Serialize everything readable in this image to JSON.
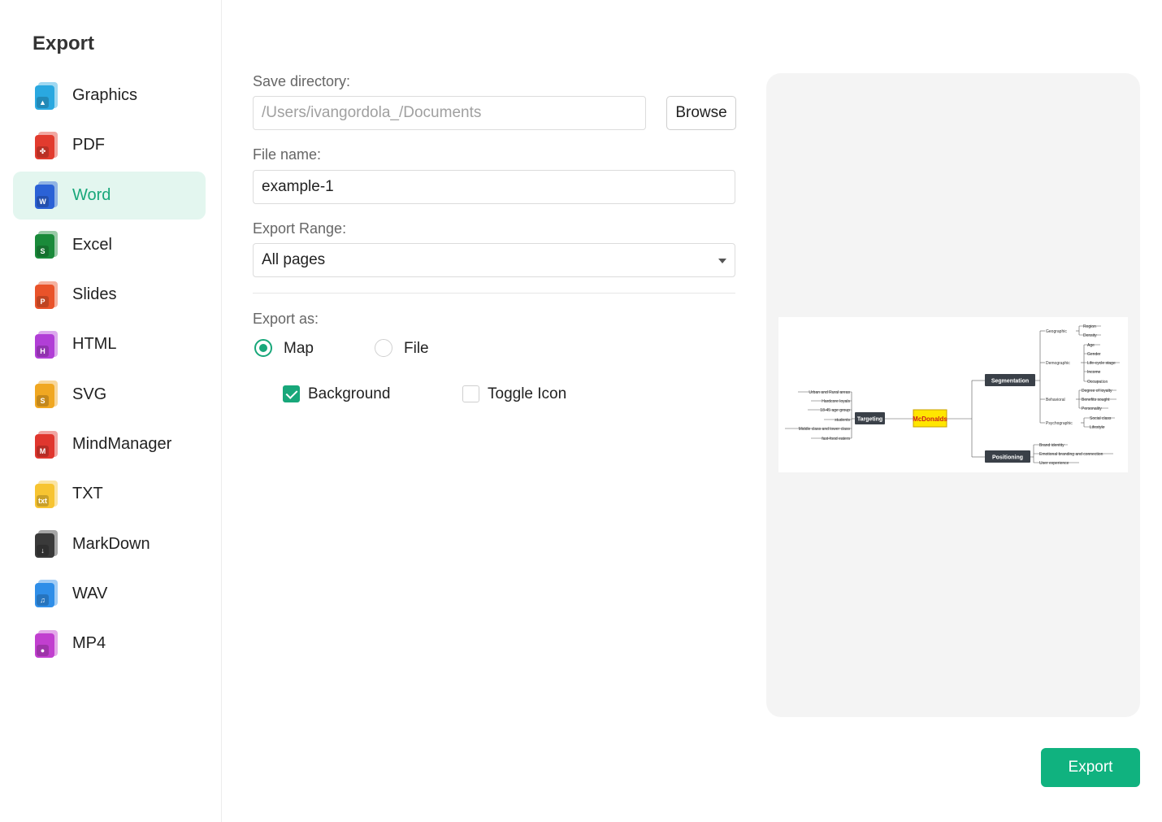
{
  "sidebar": {
    "title": "Export",
    "items": [
      {
        "label": "Graphics",
        "icon": "image-file-icon",
        "color": "#2aa8e0",
        "badge": "▲",
        "active": false
      },
      {
        "label": "PDF",
        "icon": "pdf-file-icon",
        "color": "#e23b2e",
        "badge": "✤",
        "active": false
      },
      {
        "label": "Word",
        "icon": "word-file-icon",
        "color": "#2b62d6",
        "badge": "W",
        "active": true
      },
      {
        "label": "Excel",
        "icon": "excel-file-icon",
        "color": "#1a8a3a",
        "badge": "S",
        "active": false
      },
      {
        "label": "Slides",
        "icon": "slides-file-icon",
        "color": "#e9532a",
        "badge": "P",
        "active": false
      },
      {
        "label": "HTML",
        "icon": "html-file-icon",
        "color": "#b13ed6",
        "badge": "H",
        "active": false
      },
      {
        "label": "SVG",
        "icon": "svg-file-icon",
        "color": "#f0a721",
        "badge": "S",
        "active": false
      },
      {
        "label": "MindManager",
        "icon": "mindmanager-file-icon",
        "color": "#e0362e",
        "badge": "M",
        "active": false
      },
      {
        "label": "TXT",
        "icon": "txt-file-icon",
        "color": "#f7c431",
        "badge": "txt",
        "active": false
      },
      {
        "label": "MarkDown",
        "icon": "markdown-file-icon",
        "color": "#3a3a3a",
        "badge": "↓",
        "active": false
      },
      {
        "label": "WAV",
        "icon": "wav-file-icon",
        "color": "#2f8ee8",
        "badge": "♫",
        "active": false
      },
      {
        "label": "MP4",
        "icon": "mp4-file-icon",
        "color": "#c13fcf",
        "badge": "●",
        "active": false
      }
    ]
  },
  "form": {
    "save_directory_label": "Save directory:",
    "save_directory_value": "/Users/ivangordola_/Documents",
    "browse_label": "Browse",
    "file_name_label": "File name:",
    "file_name_value": "example-1",
    "export_range_label": "Export Range:",
    "export_range_value": "All pages",
    "export_as_label": "Export as:",
    "export_as_options": [
      {
        "label": "Map",
        "checked": true
      },
      {
        "label": "File",
        "checked": false
      }
    ],
    "checkboxes": [
      {
        "label": "Background",
        "checked": true
      },
      {
        "label": "Toggle Icon",
        "checked": false
      }
    ]
  },
  "preview": {
    "center": "McDonalds",
    "left_branch": {
      "label": "Targeting",
      "children": [
        "Urban and Rural areas",
        "Hardcore loyals",
        "18-45 age group",
        "students",
        "Middle class and lower class",
        "fast-food eaters"
      ]
    },
    "segmentation": {
      "label": "Segmentation",
      "groups": [
        {
          "label": "Geographic",
          "children": [
            "Region",
            "Density"
          ]
        },
        {
          "label": "Demographic",
          "children": [
            "Age",
            "Gender",
            "Life-cycle stage",
            "Income",
            "Occupation"
          ]
        },
        {
          "label": "Behavioral",
          "children": [
            "Degree of loyalty",
            "Benefits sought",
            "Personality"
          ]
        },
        {
          "label": "Psychographic",
          "children": [
            "Social class",
            "Lifestyle"
          ]
        }
      ]
    },
    "positioning": {
      "label": "Positioning",
      "children": [
        "Brand identity",
        "Emotional branding and connection",
        "User experience"
      ]
    }
  },
  "export_button_label": "Export",
  "colors": {
    "accent": "#10b27f",
    "active_bg": "#e3f6ef",
    "close": "#ee5a52",
    "node_dark": "#3a4048",
    "center_node": "#ffe600"
  }
}
